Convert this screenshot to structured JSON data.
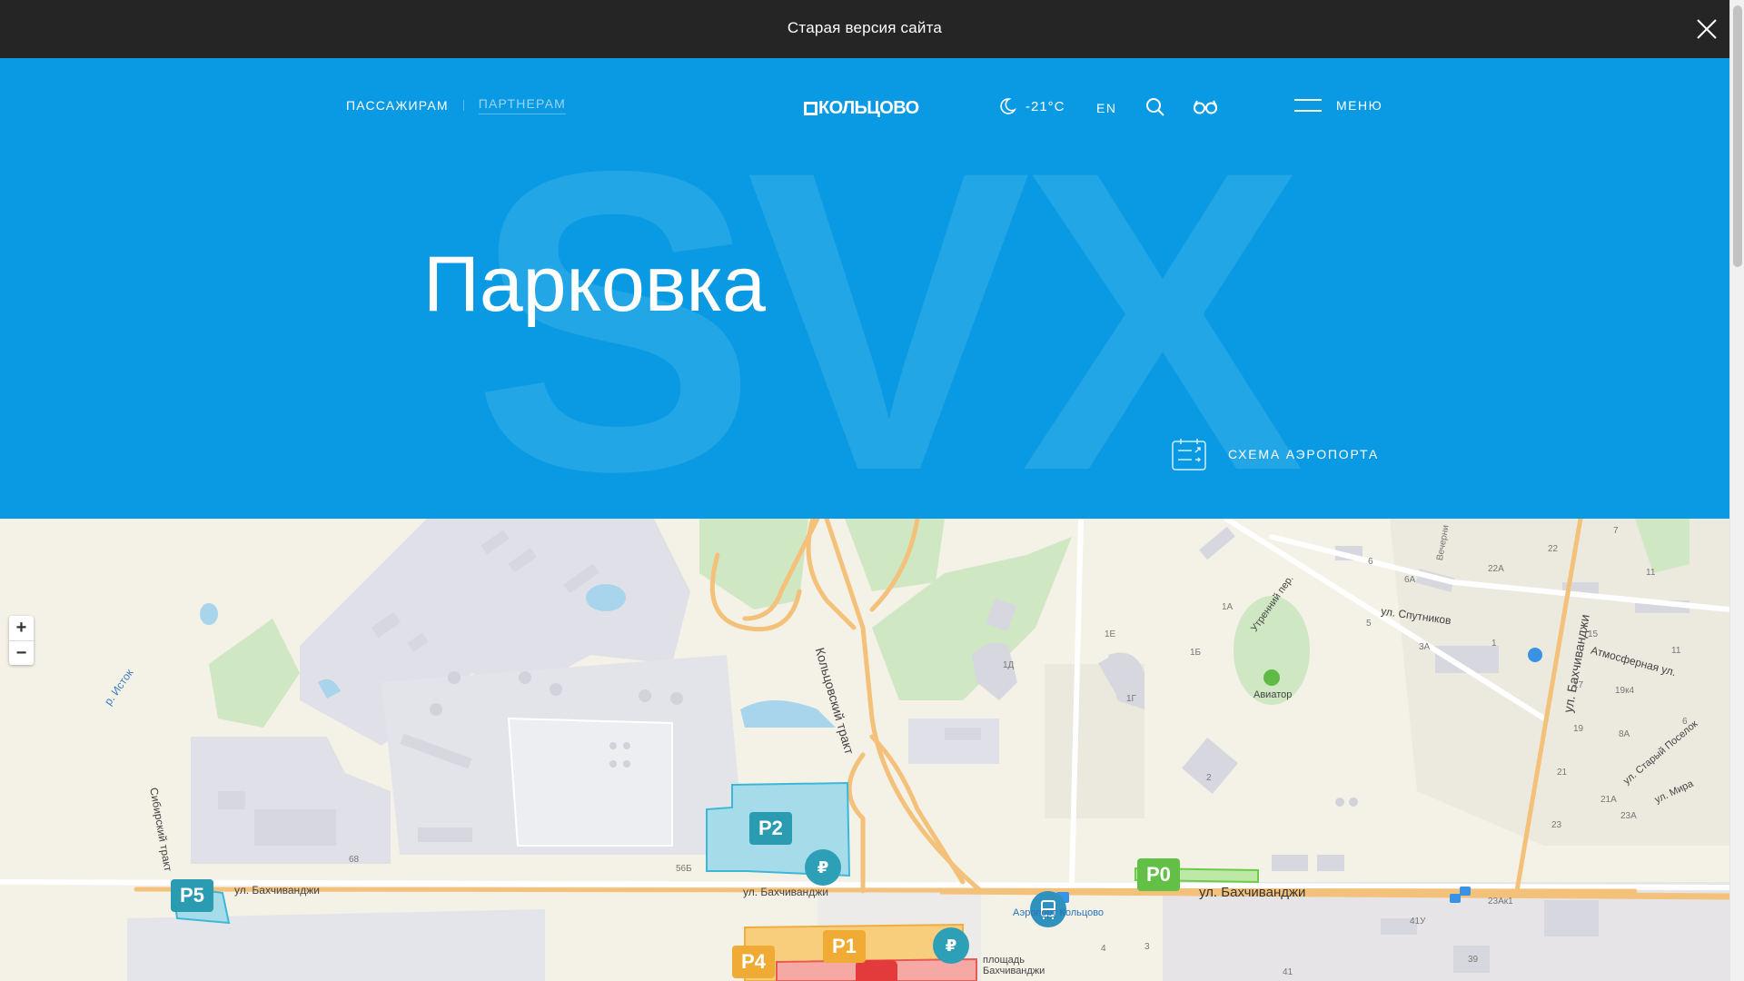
{
  "notice": {
    "text": "Старая версия сайта",
    "close_icon": "close-icon"
  },
  "header": {
    "nav": [
      {
        "label": "ПАССАЖИРАМ",
        "active": true
      },
      {
        "label": "ПАРТНЕРАМ",
        "active": false
      }
    ],
    "logo_text": "КОЛЬЦОВО",
    "weather": {
      "icon": "moon-icon",
      "temperature": "-21°C"
    },
    "lang": "EN",
    "search_icon": "search-icon",
    "accessibility_icon": "glasses-icon",
    "menu_label": "МЕНЮ"
  },
  "hero": {
    "title": "Парковка",
    "bg_letters": "SVX",
    "scheme_label": "СХЕМА АЭРОПОРТА"
  },
  "map": {
    "zoom_in": "+",
    "zoom_out": "−",
    "parkings": [
      "P0",
      "P1",
      "P2",
      "P4",
      "P5"
    ],
    "pay_symbol": "₽",
    "labels": {
      "koltsovsky": "Кольцовский тракт",
      "bakhchivandzhi_1": "ул. Бахчиванджи",
      "bakhchivandzhi_2": "ул. Бахчиванджи",
      "bakhchivandzhi_3": "ул. Бахчиванджи",
      "bakhchivandzhi_v": "ул. Бахчиванджи",
      "sibirsky": "Сибирский тракт",
      "istok": "р. Исток",
      "utrenny": "Утренний пер.",
      "sputnikov": "ул. Спутников",
      "atmosfernaya": "Атмосферная ул.",
      "stary_poselok": "ул. Старый Поселок",
      "mira": "ул. Мира",
      "aviator": "Авиатор",
      "aeroport": "Аэропорт Кольцово",
      "ploshchad": "площадь Бахчиванджи",
      "vechernyaya": "Вечерни",
      "n68": "68",
      "n56b": "56Б",
      "n2": "2",
      "n1d": "1Д",
      "n1e": "1Е",
      "n1g": "1Г",
      "n1b": "1Б",
      "n1a": "1А",
      "n6": "6",
      "n6a": "6А",
      "n5": "5",
      "n3a": "3А",
      "n1": "1",
      "n7": "7",
      "n22": "22",
      "n22a": "22А",
      "n11": "11",
      "n15": "15",
      "n17": "17",
      "n19": "19",
      "n19k4": "19к4",
      "n8a": "8А",
      "n21": "21",
      "n21a": "21А",
      "n23": "23",
      "n23a": "23А",
      "n23ak1": "23Ак1",
      "n41u": "41У",
      "n39": "39",
      "n41": "41",
      "n4": "4",
      "n3": "3",
      "n6b": "6",
      "n11b": "11"
    }
  }
}
